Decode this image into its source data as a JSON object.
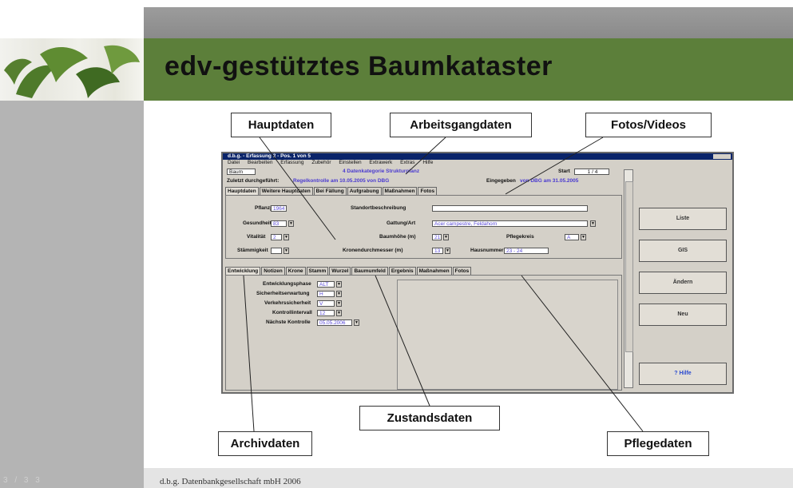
{
  "slide": {
    "title": "edv-gestütztes Baumkataster",
    "footer": "d.b.g. Datenbankgesellschaft mbH     2006",
    "page_indicator": "3 / 3 3"
  },
  "callouts": {
    "hauptdaten": "Hauptdaten",
    "arbeitsgangdaten": "Arbeitsgangdaten",
    "fotos_videos": "Fotos/Videos",
    "zustandsdaten": "Zustandsdaten",
    "archivdaten": "Archivdaten",
    "pflegedaten": "Pflegedaten"
  },
  "app": {
    "window_title": "d.b.g. - Erfassung 2 - Pos. 1 von 5",
    "menu": [
      "Datei",
      "Bearbeiten",
      "Erfassung",
      "Zubehör",
      "Einstellen",
      "Extrawerk",
      "Extras",
      "Hilfe"
    ],
    "row1": {
      "label": "Baum",
      "center": "4  Datenkategorie  Strukturplanz",
      "start_label": "Start",
      "count": "1 / 4"
    },
    "row2": {
      "label": "Zuletzt durchgeführt:",
      "value": "Regelkontrolle  am 10.05.2005  von DBG",
      "eingegeben_label": "Eingegeben",
      "eingegeben_value": "von DBG  am 31.05.2005"
    },
    "top_tabs": [
      "Hauptdaten",
      "Weitere Hauptdaten",
      "Bei Fällung",
      "Aufgrabung",
      "Maßnahmen",
      "Fotos"
    ],
    "fields": {
      "pflanzjahr_label": "Pflanzjahr",
      "pflanzjahr": "1964",
      "standort_label": "Standortbeschreibung",
      "standort": "",
      "gesundheit_label": "Gesundheit",
      "gesundheit": "83",
      "gattung_label": "Gattung/Art",
      "gattung": "Acer campestre, Feldahorn",
      "vitalitaet_label": "Vitalität",
      "vitalitaet": "2",
      "baumhoehe_label": "Baumhöhe (m)",
      "baumhoehe": "21",
      "pflegekreis_label": "Pflegekreis",
      "pflegekreis": "A",
      "staemmigkeit_label": "Stämmigkeit",
      "staemmigkeit": "",
      "krone_label": "Kronendurchmesser (m)",
      "krone": "13",
      "hausnummer_label": "Hausnummer",
      "hausnummer": "23 - 24"
    },
    "bottom_tabs": [
      "Entwicklung",
      "Notizen",
      "Krone",
      "Stamm",
      "Wurzel",
      "Baumumfeld",
      "Ergebnis",
      "Maßnahmen",
      "Fotos"
    ],
    "bottom_fields": {
      "entwicklungsphase_label": "Entwicklungsphase",
      "entwicklungsphase": "ALT",
      "sicherheit_label": "Sicherheitserwartung",
      "sicherheit": "H",
      "verkehr_label": "Verkehrssicherheit",
      "verkehr": "V",
      "kontroll_label": "Kontrollintervall",
      "kontroll": "12",
      "naechste_label": "Nächste Kontrolle",
      "naechste": "05.05.2006"
    },
    "buttons": {
      "liste": "Liste",
      "gis": "GIS",
      "aendern": "Ändern",
      "neu": "Neu",
      "hilfe": "? Hilfe"
    }
  }
}
